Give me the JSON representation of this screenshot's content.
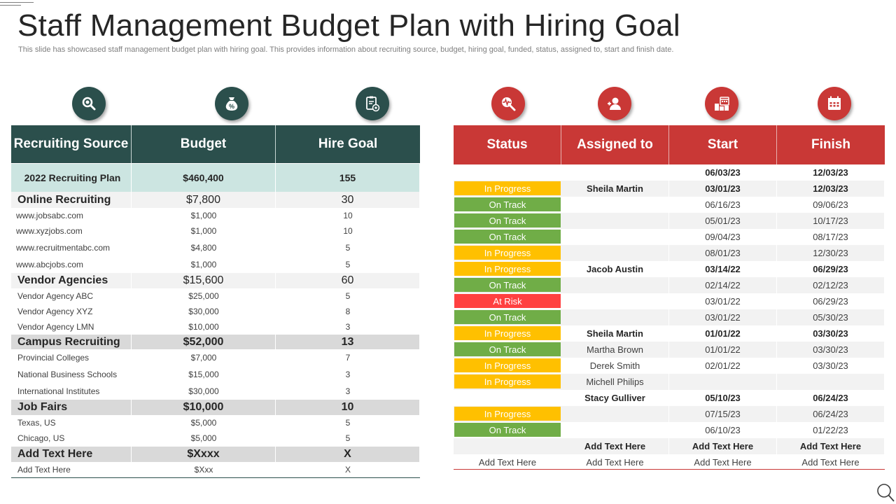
{
  "title": "Staff Management Budget Plan with Hiring Goal",
  "subtitle": "This slide has showcased staff management budget plan with hiring goal. This provides information about recruiting source, budget, hiring goal, funded, status, assigned to, start and finish date.",
  "colors": {
    "dark_green": "#2b4f4c",
    "mint": "#cce5e1",
    "red": "#c93836",
    "in_progress": "#ffc000",
    "on_track": "#70ad47",
    "at_risk": "#ff4040"
  },
  "left_icons": [
    "search-icon",
    "money-bag-icon",
    "clipboard-target-icon"
  ],
  "right_icons": [
    "heartbeat-magnifier-icon",
    "user-add-icon",
    "buildings-calendar-icon",
    "calendar-icon"
  ],
  "left_table": {
    "headers": [
      "Recruiting Source",
      "Budget",
      "Hire Goal"
    ],
    "rows": [
      {
        "source": "2022 Recruiting Plan",
        "budget": "$460,400",
        "goal": "155"
      },
      {
        "source": "Online Recruiting",
        "budget": "$7,800",
        "goal": "30"
      },
      {
        "source": "www.jobsabc.com",
        "budget": "$1,000",
        "goal": "10"
      },
      {
        "source": "www.xyzjobs.com",
        "budget": "$1,000",
        "goal": "10"
      },
      {
        "source": "www.recruitmentabc.com",
        "budget": "$4,800",
        "goal": "5"
      },
      {
        "source": "www.abcjobs.com",
        "budget": "$1,000",
        "goal": "5"
      },
      {
        "source": "Vendor Agencies",
        "budget": "$15,600",
        "goal": "60"
      },
      {
        "source": "Vendor Agency ABC",
        "budget": "$25,000",
        "goal": "5"
      },
      {
        "source": "Vendor Agency XYZ",
        "budget": "$30,000",
        "goal": "8"
      },
      {
        "source": "Vendor Agency LMN",
        "budget": "$10,000",
        "goal": "3"
      },
      {
        "source": "Campus Recruiting",
        "budget": "$52,000",
        "goal": "13"
      },
      {
        "source": "Provincial Colleges",
        "budget": "$7,000",
        "goal": "7"
      },
      {
        "source": "National Business Schools",
        "budget": "$15,000",
        "goal": "3"
      },
      {
        "source": "International Institutes",
        "budget": "$30,000",
        "goal": "3"
      },
      {
        "source": "Job Fairs",
        "budget": "$10,000",
        "goal": "10"
      },
      {
        "source": "Texas, US",
        "budget": "$5,000",
        "goal": "5"
      },
      {
        "source": "Chicago, US",
        "budget": "$5,000",
        "goal": "5"
      },
      {
        "source": "Add Text Here",
        "budget": "$Xxxx",
        "goal": "X"
      },
      {
        "source": "Add Text Here",
        "budget": "$Xxx",
        "goal": "X"
      }
    ]
  },
  "right_table": {
    "headers": [
      "Status",
      "Assigned to",
      "Start",
      "Finish"
    ],
    "rows": [
      {
        "status": "",
        "assigned": "",
        "start": "06/03/23",
        "finish": "12/03/23"
      },
      {
        "status": "In Progress",
        "assigned": "Sheila Martin",
        "start": "03/01/23",
        "finish": "12/03/23"
      },
      {
        "status": "On Track",
        "assigned": "",
        "start": "06/16/23",
        "finish": "09/06/23"
      },
      {
        "status": "On Track",
        "assigned": "",
        "start": "05/01/23",
        "finish": "10/17/23"
      },
      {
        "status": "On Track",
        "assigned": "",
        "start": "09/04/23",
        "finish": "08/17/23"
      },
      {
        "status": "In Progress",
        "assigned": "",
        "start": "08/01/23",
        "finish": "12/30/23"
      },
      {
        "status": "In Progress",
        "assigned": "Jacob Austin",
        "start": "03/14/22",
        "finish": "06/29/23"
      },
      {
        "status": "On Track",
        "assigned": "",
        "start": "02/14/22",
        "finish": "02/12/23"
      },
      {
        "status": "At Risk",
        "assigned": "",
        "start": "03/01/22",
        "finish": "06/29/23"
      },
      {
        "status": "On Track",
        "assigned": "",
        "start": "03/01/22",
        "finish": "05/30/23"
      },
      {
        "status": "In Progress",
        "assigned": "Sheila Martin",
        "start": "01/01/22",
        "finish": "03/30/23"
      },
      {
        "status": "On Track",
        "assigned": "Martha Brown",
        "start": "01/01/22",
        "finish": "03/30/23"
      },
      {
        "status": "In Progress",
        "assigned": "Derek Smith",
        "start": "02/01/22",
        "finish": "03/30/23"
      },
      {
        "status": "In Progress",
        "assigned": "Michell Philips",
        "start": "",
        "finish": ""
      },
      {
        "status": "",
        "assigned": "Stacy Gulliver",
        "start": "05/10/23",
        "finish": "06/24/23"
      },
      {
        "status": "In Progress",
        "assigned": "",
        "start": "07/15/23",
        "finish": "06/24/23"
      },
      {
        "status": "On Track",
        "assigned": "",
        "start": "06/10/23",
        "finish": "01/22/23"
      },
      {
        "status": "",
        "assigned": "Add Text Here",
        "start": "Add Text Here",
        "finish": "Add Text Here"
      },
      {
        "status": "Add Text Here",
        "assigned": "Add Text Here",
        "start": "Add Text Here",
        "finish": "Add Text Here"
      }
    ]
  }
}
